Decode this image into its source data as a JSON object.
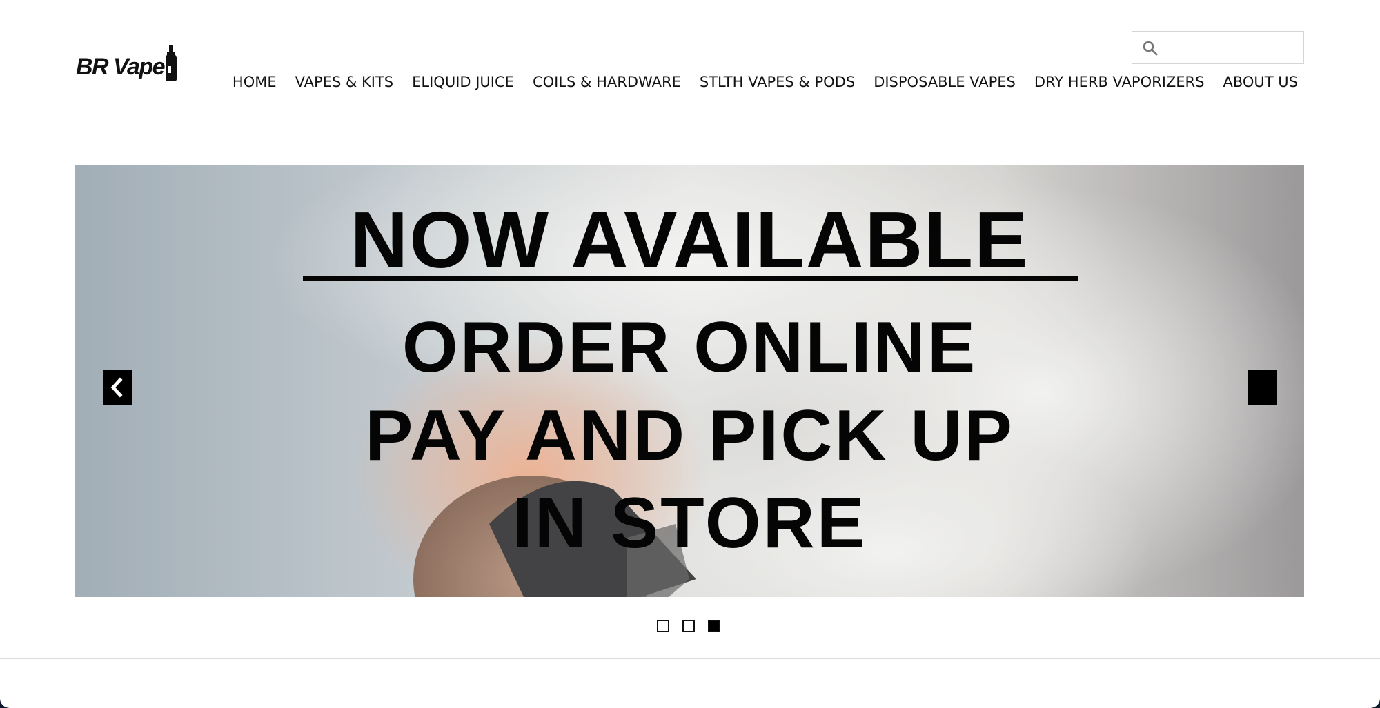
{
  "brand": {
    "logo_text": "BR Vape"
  },
  "search": {
    "placeholder": "",
    "value": ""
  },
  "nav": {
    "items": [
      "HOME",
      "VAPES & KITS",
      "ELIQUID JUICE",
      "COILS & HARDWARE",
      "STLTH VAPES & PODS",
      "DISPOSABLE VAPES",
      "DRY HERB VAPORIZERS",
      "ABOUT US"
    ]
  },
  "slider": {
    "current_slide": 3,
    "total_slides": 3,
    "banner": {
      "line1": "NOW AVAILABLE",
      "line2": "ORDER ONLINE",
      "line3": "PAY AND PICK UP",
      "line4": "IN STORE"
    },
    "icons": {
      "prev": "chevron-left-icon",
      "next": "chevron-right-icon"
    }
  },
  "colors": {
    "page_bg": "#ffffff",
    "text": "#111111",
    "accent": "#000000",
    "frame_bg": "#0f1a2e"
  }
}
